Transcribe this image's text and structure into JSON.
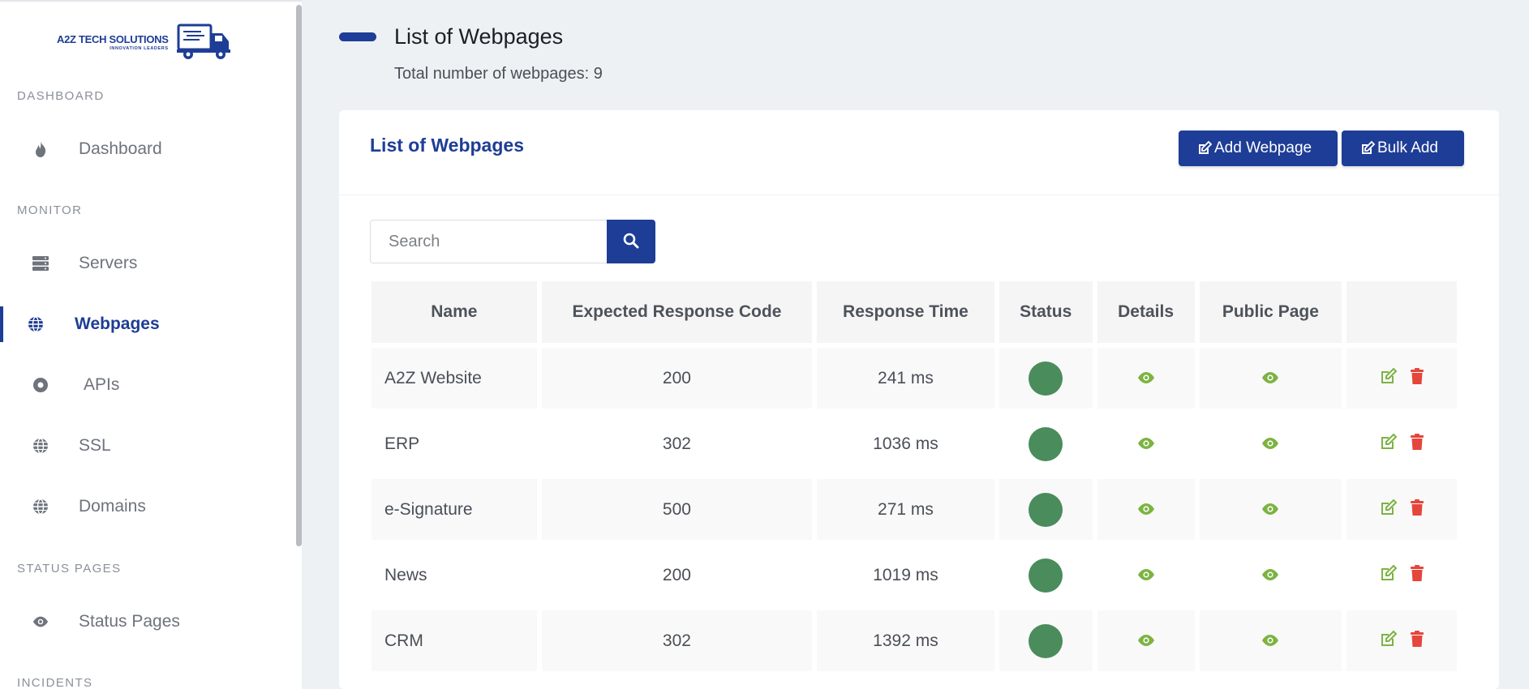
{
  "brand": {
    "name": "A2Z TECH SOLUTIONS",
    "tagline": "INNOVATION LEADERS"
  },
  "sidebar": {
    "sections": [
      {
        "title": "DASHBOARD"
      },
      {
        "title": "MONITOR"
      },
      {
        "title": "STATUS PAGES"
      },
      {
        "title": "INCIDENTS"
      }
    ],
    "items": [
      {
        "label": "Dashboard",
        "icon": "fire-icon"
      },
      {
        "label": "Servers",
        "icon": "server-icon"
      },
      {
        "label": "Webpages",
        "icon": "globe-icon",
        "active": true
      },
      {
        "label": "APIs",
        "icon": "record-icon"
      },
      {
        "label": "SSL",
        "icon": "globe-icon"
      },
      {
        "label": "Domains",
        "icon": "globe-icon"
      },
      {
        "label": "Status Pages",
        "icon": "eye-icon"
      }
    ]
  },
  "header": {
    "title": "List of Webpages",
    "subtitle": "Total number of webpages: 9"
  },
  "card": {
    "title": "List of Webpages",
    "add_button": "Add Webpage",
    "bulk_button": "Bulk Add"
  },
  "search": {
    "placeholder": "Search"
  },
  "table": {
    "columns": [
      "Name",
      "Expected Response Code",
      "Response Time",
      "Status",
      "Details",
      "Public Page",
      ""
    ],
    "rows": [
      {
        "name": "A2Z Website",
        "code": "200",
        "time": "241 ms",
        "status": "up"
      },
      {
        "name": "ERP",
        "code": "302",
        "time": "1036 ms",
        "status": "up"
      },
      {
        "name": "e-Signature",
        "code": "500",
        "time": "271 ms",
        "status": "up"
      },
      {
        "name": "News",
        "code": "200",
        "time": "1019 ms",
        "status": "up"
      },
      {
        "name": "CRM",
        "code": "302",
        "time": "1392 ms",
        "status": "up"
      }
    ]
  },
  "colors": {
    "accent": "#1e3d96",
    "status_up": "#4a8c5c",
    "view_icon": "#7cb342",
    "edit_icon": "#7cb342",
    "delete_icon": "#e5453b"
  }
}
